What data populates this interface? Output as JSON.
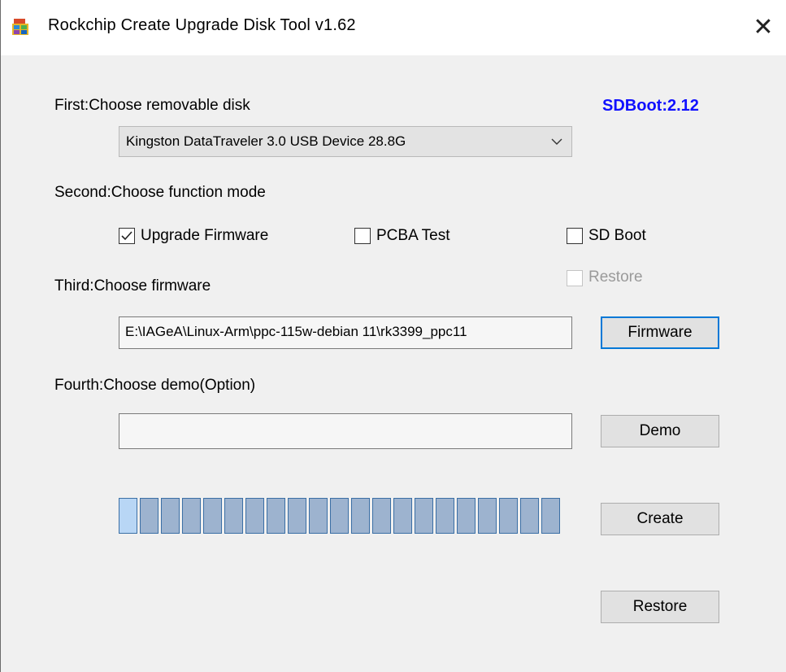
{
  "window": {
    "title": "Rockchip Create Upgrade Disk Tool v1.62",
    "close_glyph": "✕",
    "app_icon": "rockchip-app-icon"
  },
  "header": {
    "sdboot_version": "SDBoot:2.12",
    "sdboot_color": "#1010ff"
  },
  "step1": {
    "label": "First:Choose removable disk",
    "disk_select_value": "Kingston DataTraveler 3.0 USB Device   28.8G"
  },
  "step2": {
    "label": "Second:Choose function mode",
    "options": [
      {
        "label": "Upgrade Firmware",
        "checked": true,
        "enabled": true
      },
      {
        "label": "PCBA Test",
        "checked": false,
        "enabled": true
      },
      {
        "label": "SD Boot",
        "checked": false,
        "enabled": true
      },
      {
        "label": "Restore",
        "checked": false,
        "enabled": false
      }
    ]
  },
  "step3": {
    "label": "Third:Choose firmware",
    "firmware_path": "E:\\IAGeA\\Linux-Arm\\ppc-115w-debian 11\\rk3399_ppc11",
    "firmware_button": "Firmware"
  },
  "step4": {
    "label": "Fourth:Choose demo(Option)",
    "demo_path": "",
    "demo_button": "Demo"
  },
  "progress": {
    "segments": 21,
    "filled": 1,
    "fill_color": "#b8d6f5"
  },
  "actions": {
    "create_button": "Create",
    "restore_button": "Restore"
  },
  "colors": {
    "focus_border": "#0078d7",
    "client_bg": "#f0f0f0"
  }
}
